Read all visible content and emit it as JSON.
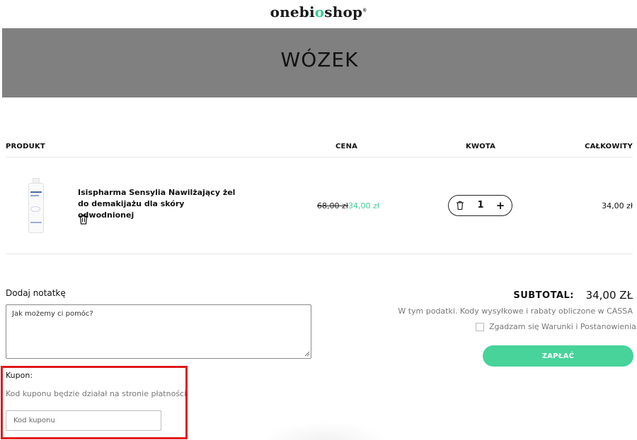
{
  "logo": {
    "part1": "onebi",
    "part2": "o",
    "part3": "shop",
    "mark": "®"
  },
  "banner": {
    "title": "WÓZEK"
  },
  "table": {
    "headers": {
      "product": "PRODUKT",
      "price": "CENA",
      "quantity": "KWOTA",
      "total": "CAŁKOWITY"
    },
    "items": [
      {
        "name": "Isispharma Sensylia Nawilżający żel do demakijażu dla skóry odwodnionej",
        "old_price": "68,00 zł",
        "price": "34,00 zł",
        "quantity": "1",
        "line_total": "34,00 zł",
        "remove_icon": "trash-icon",
        "decrement_icon": "trash-icon",
        "increment_icon": "plus-icon"
      }
    ]
  },
  "note": {
    "label": "Dodaj notatkę",
    "placeholder": "Jak możemy ci pomóc?",
    "value": ""
  },
  "coupon": {
    "label": "Kupon:",
    "info": "Kod kuponu będzie działał na stronie płatności",
    "placeholder": "Kod kuponu",
    "value": "",
    "highlight_color": "#e0191b"
  },
  "summary": {
    "subtotal_label": "SUBTOTAL:",
    "subtotal_value": "34,00 ZŁ",
    "tax_note": "W tym podatki. Kody wysyłkowe i rabaty obliczone w CASSA",
    "terms_label": "Zgadzam się Warunki i Postanowienia.",
    "terms_checked": false,
    "pay_button": "ZAPŁAĆ"
  },
  "colors": {
    "accent": "#3ccf91",
    "pay_button": "#47d39a",
    "banner": "#808080"
  }
}
